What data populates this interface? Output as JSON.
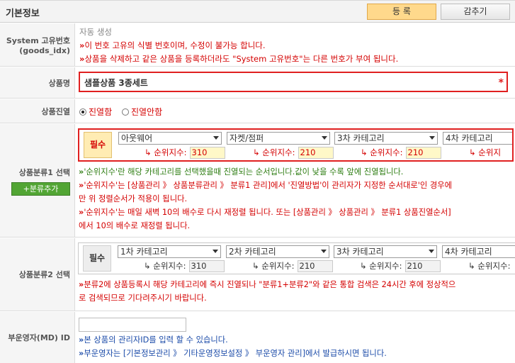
{
  "header": {
    "title": "기본정보",
    "register_label": "등 록",
    "hide_label": "감추기"
  },
  "system_id": {
    "label_line1": "System 고유번호",
    "label_line2": "(goods_idx)",
    "value": "자동 생성",
    "notes": [
      "이 번호 고유의 식별 번호이며, 수정이 불가능 합니다.",
      "상품을 삭제하고 같은 상품을 등록하더라도 \"System 고유번호\"는 다른 번호가 부여 됩니다."
    ]
  },
  "product_name": {
    "label": "상품명",
    "value": "샘플상품 3종세트",
    "required_mark": "*"
  },
  "display": {
    "label": "상품진열",
    "options": [
      "진열함",
      "진열안함"
    ],
    "selected": "진열함"
  },
  "category1": {
    "label": "상품분류1 선택",
    "add_button": "+분류추가",
    "required_label": "필수",
    "selects": [
      "아웃웨어",
      "자켓/점퍼",
      "3차 카테고리",
      "4차 카테고리"
    ],
    "rank_label": "순위지수:",
    "ranks": [
      "310",
      "210",
      "210",
      ""
    ],
    "notes": [
      "'순위지수'란 해당 카테고리를 선택했을때 진열되는 순서입니다.값이 낮을 수록 앞에 진열됩니다.",
      "'순위지수'는 [상품관리 》 상품분류관리 》 분류1 관리]에서 '진열방법'이 관리자가 지정한 순서대로'인 경우에",
      "만 위 정렬순서가 적용이 됩니다.",
      "'순위지수'는 매일 새벽 10의 배수로 다시 재정렬 됩니다. 또는 [상품관리 》 상품관리 》 분류1 상품진열순서]",
      "에서 10의 배수로 재정렬 됩니다."
    ]
  },
  "category2": {
    "label": "상품분류2 선택",
    "required_label": "필수",
    "selects": [
      "1차 카테고리",
      "2차 카테고리",
      "3차 카테고리",
      "4차 카테고리"
    ],
    "rank_label": "순위지수:",
    "ranks": [
      "310",
      "210",
      "210",
      ""
    ],
    "notes": [
      "분류2에 상품등록시 해당 카테고리에 즉시 진열되나 \"분류1+분류2\"와 같은 통합 검색은 24시간 후에 정상적으",
      "로 검색되므로 기다려주시기 바랍니다."
    ]
  },
  "md": {
    "label": "부운영자(MD) ID",
    "value": "",
    "notes": [
      "본 상품의 관리자ID를 입력 할 수 있습니다.",
      "부운영자는 [기본정보관리 》 기타운영정보설정 》 부운영자 관리]에서 발급하시면 됩니다."
    ]
  },
  "colors": {
    "accent_red": "#d40000",
    "required_bg": "#ffecb3",
    "register_bg": "#ffd98c",
    "add_button_bg": "#52a534"
  }
}
